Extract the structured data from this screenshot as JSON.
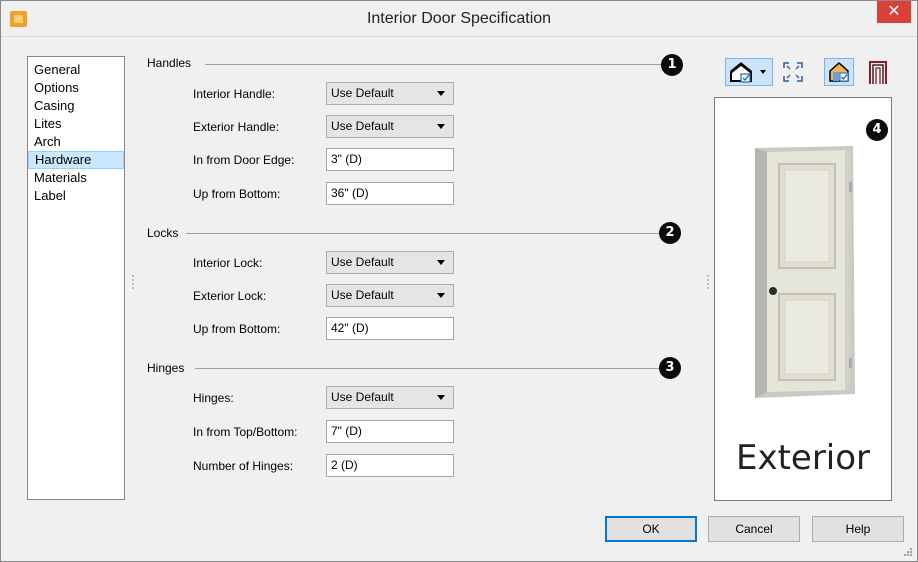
{
  "window": {
    "title": "Interior Door Specification",
    "close_glyph": "✕"
  },
  "sidebar": {
    "items": [
      {
        "label": "General"
      },
      {
        "label": "Options"
      },
      {
        "label": "Casing"
      },
      {
        "label": "Lites"
      },
      {
        "label": "Arch"
      },
      {
        "label": "Hardware",
        "selected": true
      },
      {
        "label": "Materials"
      },
      {
        "label": "Label"
      }
    ]
  },
  "sections": {
    "handles": {
      "title": "Handles",
      "callout": "1",
      "interior_handle": {
        "label": "Interior Handle:",
        "value": "Use Default"
      },
      "exterior_handle": {
        "label": "Exterior Handle:",
        "value": "Use Default"
      },
      "in_from_door_edge": {
        "label": "In from Door Edge:",
        "value": "3\" (D)"
      },
      "up_from_bottom": {
        "label": "Up from Bottom:",
        "value": "36\" (D)"
      }
    },
    "locks": {
      "title": "Locks",
      "callout": "2",
      "interior_lock": {
        "label": "Interior Lock:",
        "value": "Use Default"
      },
      "exterior_lock": {
        "label": "Exterior Lock:",
        "value": "Use Default"
      },
      "up_from_bottom": {
        "label": "Up from Bottom:",
        "value": "42\" (D)"
      }
    },
    "hinges": {
      "title": "Hinges",
      "callout": "3",
      "hinges": {
        "label": "Hinges:",
        "value": "Use Default"
      },
      "in_from_top_bottom": {
        "label": "In from Top/Bottom:",
        "value": "7\" (D)"
      },
      "number_of_hinges": {
        "label": "Number of Hinges:",
        "value": "2 (D)"
      }
    }
  },
  "preview": {
    "callout": "4",
    "label": "Exterior",
    "toolbar_icons": [
      "view-mode-icon",
      "fit-to-window-icon",
      "material-preview-icon",
      "door-frame-icon"
    ]
  },
  "buttons": {
    "ok": "OK",
    "cancel": "Cancel",
    "help": "Help"
  },
  "colors": {
    "selection": "#cce8ff",
    "close_button": "#d9403a",
    "app_icon": "#f3a02a",
    "default_button_border": "#0078d7"
  }
}
